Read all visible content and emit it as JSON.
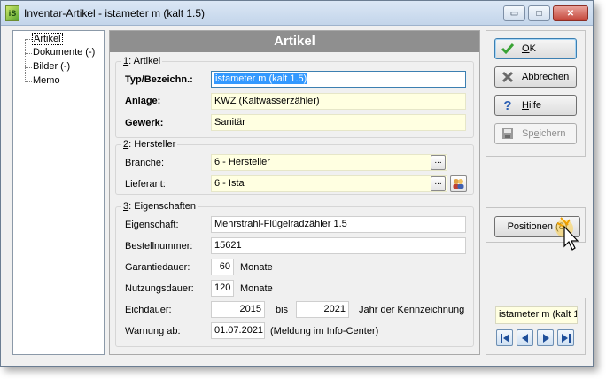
{
  "window": {
    "title": "Inventar-Artikel - istameter m (kalt 1.5)",
    "app_icon": "inventory-app-icon",
    "controls": {
      "minimize": "▭",
      "maximize": "□",
      "close": "✕"
    }
  },
  "tree": {
    "items": [
      {
        "label": "Artikel",
        "selected": true
      },
      {
        "label": "Dokumente (-)"
      },
      {
        "label": "Bilder (-)"
      },
      {
        "label": "Memo"
      }
    ]
  },
  "main": {
    "header": "Artikel",
    "artikel": {
      "legend_num": "1",
      "legend_text": ": Artikel",
      "typ_label": "Typ/Bezeichn.:",
      "typ_value": "istameter m (kalt 1.5)",
      "anlage_label": "Anlage:",
      "anlage_value": "KWZ (Kaltwasserzähler)",
      "gewerk_label": "Gewerk:",
      "gewerk_value": "Sanitär"
    },
    "hersteller": {
      "legend_num": "2",
      "legend_text": ": Hersteller",
      "branche_label": "Branche:",
      "branche_value": "6 - Hersteller",
      "lieferant_label": "Lieferant:",
      "lieferant_value": "6 - Ista",
      "ellipsis": "..."
    },
    "eigenschaften": {
      "legend_num": "3",
      "legend_text": ": Eigenschaften",
      "eigenschaft_label": "Eigenschaft:",
      "eigenschaft_value": "Mehrstrahl-Flügelradzähler 1.5",
      "bestellnummer_label": "Bestellnummer:",
      "bestellnummer_value": "15621",
      "garantie_label": "Garantiedauer:",
      "garantie_value": "60",
      "garantie_unit": "Monate",
      "nutzung_label": "Nutzungsdauer:",
      "nutzung_value": "120",
      "nutzung_unit": "Monate",
      "eich_label": "Eichdauer:",
      "eich_from": "2015",
      "eich_bis": "bis",
      "eich_to": "2021",
      "eich_suffix": "Jahr der Kennzeichnung",
      "warnung_label": "Warnung ab:",
      "warnung_value": "01.07.2021",
      "warnung_note": "(Meldung im Info-Center)"
    }
  },
  "buttons": {
    "ok": {
      "accel": "O",
      "rest": "K"
    },
    "abbrechen": {
      "prefix": "Abbr",
      "accel": "e",
      "rest": "chen"
    },
    "hilfe": {
      "accel": "H",
      "rest": "ilfe"
    },
    "speichern": {
      "prefix": "Sp",
      "accel": "e",
      "rest": "ichern"
    },
    "positionen": "Positionen (8)"
  },
  "navigator": {
    "value": "istameter m (kalt 1.",
    "first": "first-record-icon",
    "prev": "previous-record-icon",
    "next": "next-record-icon",
    "last": "last-record-icon"
  },
  "colors": {
    "header_bg": "#8f8f8f",
    "field_yellow": "#ffffe1",
    "selection": "#3399ff"
  }
}
